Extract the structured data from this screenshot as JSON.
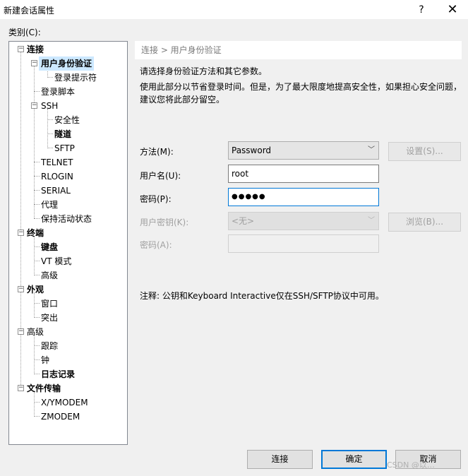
{
  "window": {
    "title": "新建会话属性",
    "help_glyph": "?",
    "close_glyph": "✕"
  },
  "category_label": "类别(C):",
  "tree": {
    "connection": "连接",
    "auth": "用户身份验证",
    "login_prompt": "登录提示符",
    "login_script": "登录脚本",
    "ssh": "SSH",
    "security": "安全性",
    "tunnel": "隧道",
    "sftp": "SFTP",
    "telnet": "TELNET",
    "rlogin": "RLOGIN",
    "serial": "SERIAL",
    "proxy": "代理",
    "keepalive": "保持活动状态",
    "terminal": "终端",
    "keyboard": "键盘",
    "vt_mode": "VT 模式",
    "term_advanced": "高级",
    "appearance": "外观",
    "window": "窗口",
    "highlight": "突出",
    "advanced": "高级",
    "trace": "跟踪",
    "bell": "钟",
    "logging": "日志记录",
    "file_transfer": "文件传输",
    "xymodem": "X/YMODEM",
    "zmodem": "ZMODEM"
  },
  "panel": {
    "breadcrumb": "连接 > 用户身份验证",
    "desc1": "请选择身份验证方法和其它参数。",
    "desc2": "使用此部分以节省登录时间。但是，为了最大限度地提高安全性，如果担心安全问题，",
    "desc3": "建议您将此部分留空。",
    "method_label": "方法(M):",
    "method_value": "Password",
    "settings_button": "设置(S)...",
    "username_label": "用户名(U):",
    "username_value": "root",
    "password_label": "密码(P):",
    "password_mask": "●●●●●",
    "userkey_label": "用户密钥(K):",
    "userkey_value": "<无>",
    "browse_button": "浏览(B)...",
    "passphrase_label": "密码(A):",
    "note": "注释: 公钥和Keyboard Interactive仅在SSH/SFTP协议中可用。"
  },
  "buttons": {
    "connect": "连接",
    "ok": "确定",
    "cancel": "取消"
  },
  "watermark": "CSDN @以…"
}
